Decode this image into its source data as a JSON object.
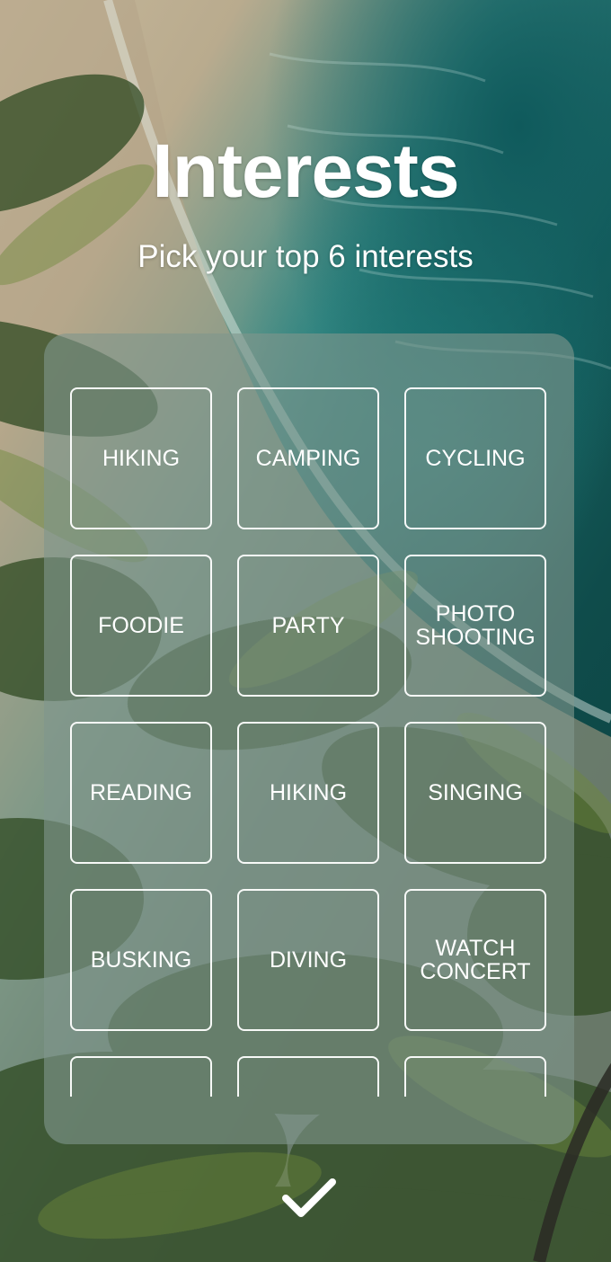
{
  "header": {
    "title": "Interests",
    "subtitle": "Pick your top 6 interests"
  },
  "interests": [
    {
      "label": "HIKING"
    },
    {
      "label": "CAMPING"
    },
    {
      "label": "CYCLING"
    },
    {
      "label": "FOODIE"
    },
    {
      "label": "PARTY"
    },
    {
      "label": "PHOTO\nSHOOTING"
    },
    {
      "label": "READING"
    },
    {
      "label": "HIKING"
    },
    {
      "label": "SINGING"
    },
    {
      "label": "BUSKING"
    },
    {
      "label": "DIVING"
    },
    {
      "label": "WATCH\nCONCERT"
    },
    {
      "label": ""
    },
    {
      "label": ""
    },
    {
      "label": ""
    }
  ],
  "confirm": {
    "icon": "checkmark-icon"
  },
  "colors": {
    "panel": "#80968c",
    "text": "#ffffff",
    "tile_border": "#ffffff"
  }
}
